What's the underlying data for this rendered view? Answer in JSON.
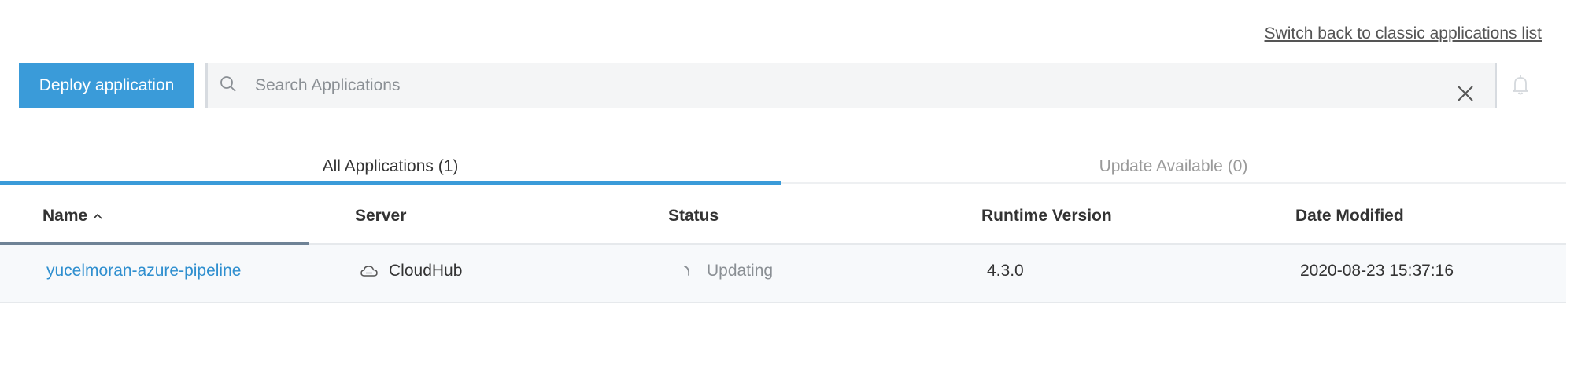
{
  "header": {
    "switch_link": "Switch back to classic applications list"
  },
  "toolbar": {
    "deploy_label": "Deploy application",
    "search": {
      "placeholder": "Search Applications",
      "value": ""
    }
  },
  "tabs": [
    {
      "label": "All Applications (1)",
      "active": true
    },
    {
      "label": "Update Available (0)",
      "active": false
    }
  ],
  "table": {
    "columns": [
      "Name",
      "Server",
      "Status",
      "Runtime Version",
      "Date Modified"
    ],
    "sort": {
      "column": "Name",
      "direction": "ascending"
    },
    "rows": [
      {
        "name": "yucelmoran-azure-pipeline",
        "server": "CloudHub",
        "status": "Updating",
        "runtime": "4.3.0",
        "date_modified": "2020-08-23 15:37:16"
      }
    ]
  },
  "icons": {
    "search": "search-icon",
    "clear": "close-icon",
    "notifications": "bell-icon",
    "server": "cloud-icon",
    "status": "spinner-icon",
    "sort": "chevron-up-icon"
  },
  "colors": {
    "accent": "#3a9bd9",
    "link": "#2f8fcf",
    "muted_text": "#8a8f94",
    "row_background": "#f7f9fb"
  }
}
